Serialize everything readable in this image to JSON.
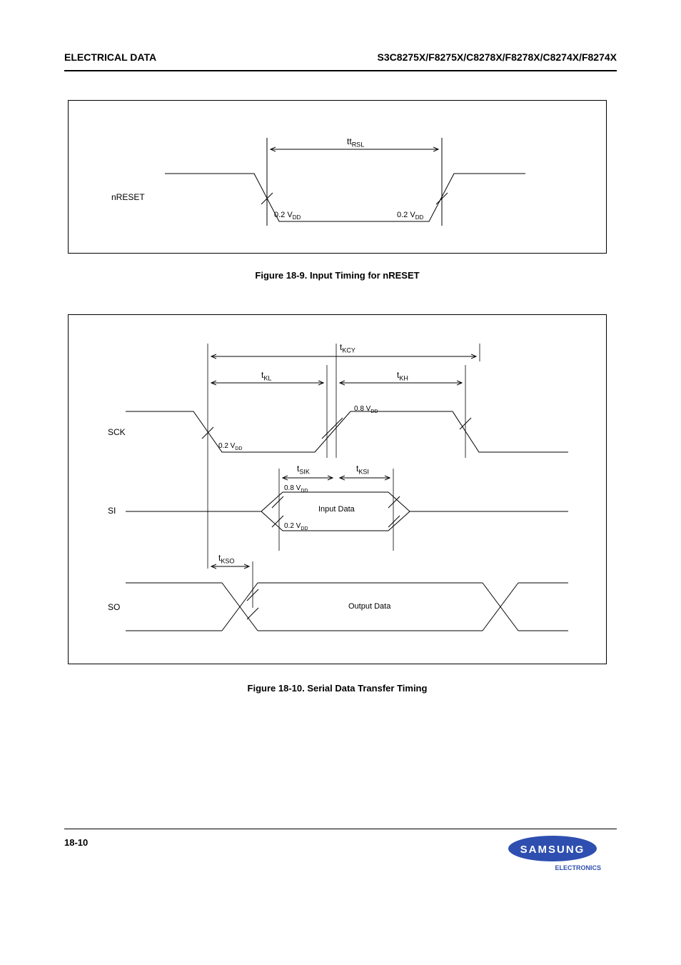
{
  "header": {
    "left": "ELECTRICAL DATA",
    "right": "S3C8275X/F8275X/C8278X/F8278X/C8274X/F8274X"
  },
  "fig1": {
    "signal": "nRESET",
    "t_label": "tRSL",
    "vlow_left": "0.2 VDD",
    "vlow_right": "0.2 VDD",
    "caption": "Figure 18-9. Input Timing for nRESET"
  },
  "fig2": {
    "sck": {
      "signal": "SCK",
      "t_kcy": "tKCY",
      "t_kl": "tKL",
      "t_kh": "tKH",
      "vh": "0.8 VDD",
      "vl": "0.2 VDD"
    },
    "si": {
      "signal": "SI",
      "t_sik": "tSIK",
      "t_ksi": "tKSI",
      "vh": "0.8 VDD",
      "vl": "0.2 VDD",
      "data": "Input Data"
    },
    "so": {
      "signal": "SO",
      "t_kso": "tKSO",
      "data": "Output Data"
    },
    "caption": "Figure 18-10. Serial Data Transfer Timing"
  },
  "footer": {
    "page": "18-10",
    "brand": "SAMSUNG",
    "sub": "ELECTRONICS"
  }
}
